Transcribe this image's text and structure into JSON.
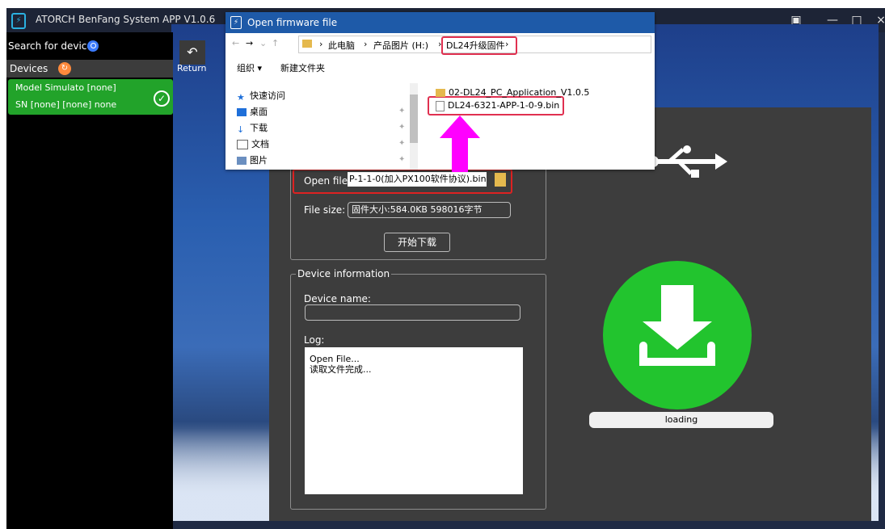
{
  "app": {
    "title": "ATORCH BenFang System APP V1.0.6",
    "window_controls": [
      "▣",
      "—",
      "□",
      "×"
    ]
  },
  "sidebar": {
    "search_label": "Search for device",
    "devices_label": "Devices",
    "device": {
      "model_line": "Model Simulato [none]",
      "sn_line": "SN    [none]   [none]     none"
    }
  },
  "return_label": "Return",
  "firmware": {
    "open_label": "Open file:",
    "open_value": "P-1-1-0(加入PX100软件协议).bin",
    "size_label": "File size:",
    "size_value": "固件大小:584.0KB  598016字节",
    "download_button": "开始下载"
  },
  "device_info": {
    "legend": "Device information",
    "name_label": "Device name:",
    "log_label": "Log:",
    "log_lines": [
      "Open File...",
      "读取文件完成..."
    ]
  },
  "status": {
    "loading": "loading"
  },
  "dialog": {
    "title": "Open firmware file",
    "breadcrumbs": [
      "此电脑",
      "产品图片 (H:)",
      "DL24升级固件"
    ],
    "toolbar": {
      "organize": "组织 ▾",
      "new_folder": "新建文件夹"
    },
    "nav_items": [
      "快速访问",
      "桌面",
      "下载",
      "文档",
      "图片"
    ],
    "files": [
      "02-DL24_PC_Application_V1.0.5",
      "DL24-6321-APP-1-0-9.bin"
    ]
  },
  "colors": {
    "accent_green": "#22c42e",
    "highlight_red": "#e03050",
    "arrow_magenta": "#ff00ff",
    "title_blue": "#1e5aa8"
  }
}
